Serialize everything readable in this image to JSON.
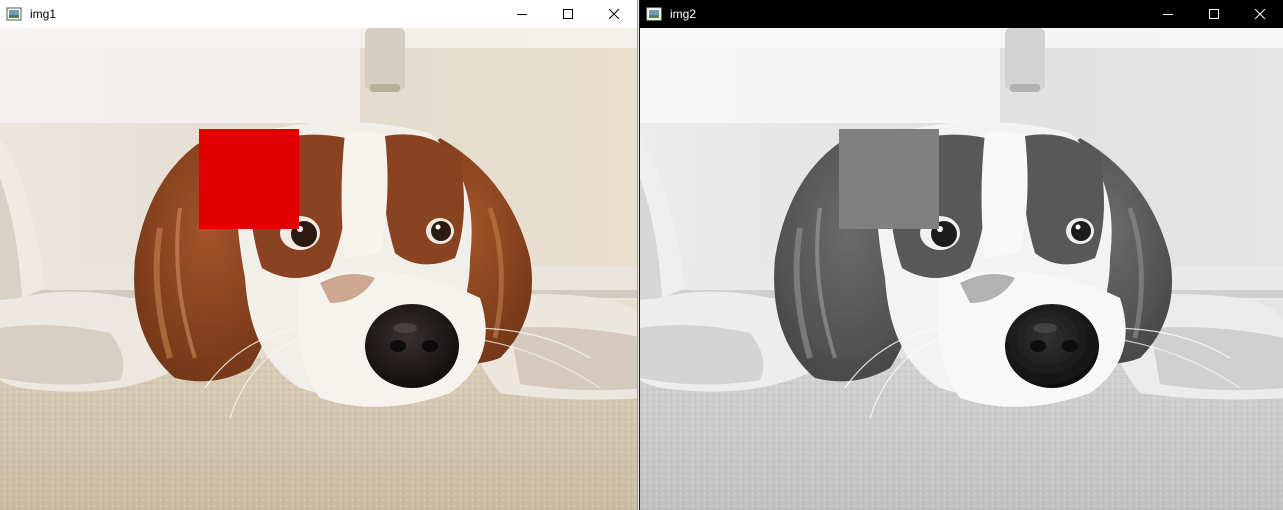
{
  "windows": [
    {
      "title": "img1",
      "theme": "light",
      "image": "color-photo-dog",
      "overlay_color": "#e00000"
    },
    {
      "title": "img2",
      "theme": "dark",
      "image": "grayscale-photo-dog",
      "overlay_color": "#808080"
    }
  ],
  "icons": {
    "app": "image-window-icon",
    "minimize": "minimize-icon",
    "maximize": "maximize-icon",
    "close": "close-icon"
  }
}
